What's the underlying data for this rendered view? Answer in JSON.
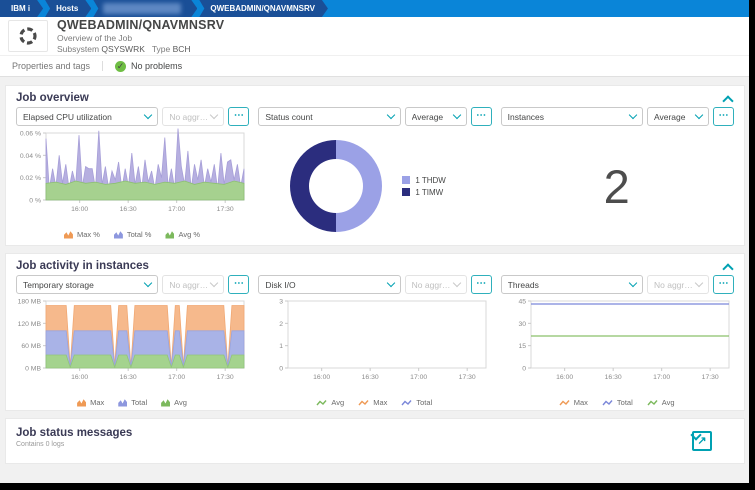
{
  "breadcrumb": {
    "items": [
      {
        "label": "IBM i",
        "redacted": false
      },
      {
        "label": "Hosts",
        "redacted": false
      },
      {
        "label": "",
        "redacted": true
      },
      {
        "label": "QWEBADMIN/QNAVMNSRV",
        "redacted": false
      }
    ]
  },
  "header": {
    "title": "QWEBADMIN/QNAVMNSRV",
    "subtitle": "Overview of the Job",
    "meta_label_1": "Subsystem",
    "meta_value_1": "QSYSWRK",
    "meta_label_2": "Type",
    "meta_value_2": "BCH"
  },
  "tabs": {
    "properties": "Properties and tags",
    "no_problems": "No problems"
  },
  "sections": {
    "overview_title": "Job overview",
    "activity_title": "Job activity in instances",
    "messages_title": "Job status messages",
    "messages_subtitle": "Contains 0 logs"
  },
  "colors": {
    "accent_teal": "#00a1b2",
    "topbar_blue": "#0a85d8",
    "breadcrumb_blue": "#1a4f97",
    "ok_green": "#6fbe44",
    "area_purple": "#b6afe0",
    "area_green": "#a6d18f",
    "band_orange": "#f6b98c",
    "band_blue": "#a9b3e7",
    "band_green": "#a4d38e",
    "donut_light": "#9ba1e6",
    "donut_dark": "#2b2d7e",
    "line_blue": "#7b87d9",
    "line_green": "#8ac06a"
  },
  "chart_data": [
    {
      "key": "cpu",
      "metric": "Elapsed CPU utilization",
      "aggregation": "No aggregation",
      "aggregation_enabled": false,
      "type": "area",
      "ylim": [
        0,
        0.06
      ],
      "yticks": [
        {
          "v": 0.06,
          "label": "0.06 %"
        },
        {
          "v": 0.04,
          "label": "0.04 %"
        },
        {
          "v": 0.02,
          "label": "0.02 %"
        },
        {
          "v": 0,
          "label": "0 %"
        }
      ],
      "xticks": [
        "16:00",
        "16:30",
        "17:00",
        "17:30"
      ],
      "series": [
        {
          "name": "Total %",
          "draw": "area",
          "color": "#b6afe0",
          "stroke": "#a79fd8",
          "values": [
            0.055,
            0.01,
            0.028,
            0.012,
            0.04,
            0.015,
            0.032,
            0.01,
            0.026,
            0.014,
            0.058,
            0.012,
            0.03,
            0.028,
            0.028,
            0.01,
            0.062,
            0.014,
            0.03,
            0.01,
            0.026,
            0.018,
            0.034,
            0.01,
            0.028,
            0.012,
            0.042,
            0.014,
            0.03,
            0.01,
            0.036,
            0.016,
            0.026,
            0.01,
            0.032,
            0.02,
            0.056,
            0.012,
            0.028,
            0.01,
            0.064,
            0.03,
            0.014,
            0.044,
            0.01,
            0.032,
            0.018,
            0.036,
            0.012,
            0.028,
            0.016,
            0.032,
            0.01,
            0.042,
            0.014,
            0.034,
            0.036,
            0.018,
            0.032,
            0.012,
            0.028
          ]
        },
        {
          "name": "Avg %",
          "draw": "area",
          "color": "#a6d18f",
          "stroke": "#8cbf72",
          "values": [
            0.015,
            0.016,
            0.014,
            0.017,
            0.015,
            0.016,
            0.014,
            0.015,
            0.017,
            0.015,
            0.016,
            0.014,
            0.016,
            0.015,
            0.017,
            0.014,
            0.016,
            0.015,
            0.014,
            0.017,
            0.015
          ]
        }
      ],
      "legend": [
        {
          "label": "Max %",
          "color": "#ef9a55",
          "style": "area"
        },
        {
          "label": "Total %",
          "color": "#8d97de",
          "style": "area"
        },
        {
          "label": "Avg %",
          "color": "#7cb95d",
          "style": "area"
        }
      ]
    },
    {
      "key": "status",
      "metric": "Status count",
      "aggregation": "Average",
      "aggregation_enabled": true,
      "type": "pie",
      "slices": [
        {
          "label": "1 THDW",
          "value": 1,
          "color": "#9ba1e6"
        },
        {
          "label": "1 TIMW",
          "value": 1,
          "color": "#2b2d7e"
        }
      ]
    },
    {
      "key": "instances",
      "metric": "Instances",
      "aggregation": "Average",
      "aggregation_enabled": true,
      "type": "number",
      "value": "2"
    },
    {
      "key": "tempstorage",
      "metric": "Temporary storage",
      "aggregation": "No aggregation",
      "aggregation_enabled": false,
      "type": "area",
      "ylim": [
        0,
        180
      ],
      "yticks": [
        {
          "v": 180,
          "label": "180 MB"
        },
        {
          "v": 120,
          "label": "120 MB"
        },
        {
          "v": 60,
          "label": "60 MB"
        },
        {
          "v": 0,
          "label": "0 MB"
        }
      ],
      "xticks": [
        "16:00",
        "16:30",
        "17:00",
        "17:30"
      ],
      "series": [
        {
          "name": "Max",
          "draw": "area",
          "color": "#f6b98c",
          "stroke": "#f1a873",
          "values": [
            168,
            168,
            168,
            168,
            168,
            168,
            5,
            168,
            168,
            168,
            168,
            168,
            168,
            168,
            168,
            168,
            168,
            6,
            168,
            168,
            168,
            4,
            168,
            168,
            168,
            168,
            168,
            168,
            168,
            168,
            168,
            5,
            168,
            168,
            6,
            168,
            168,
            168,
            168,
            168,
            168,
            168,
            168,
            168,
            168,
            4,
            168,
            168,
            168,
            168
          ]
        },
        {
          "name": "Total",
          "draw": "area",
          "color": "#a9b3e7",
          "stroke": "#99a4de",
          "values": [
            100,
            100,
            100,
            100,
            100,
            100,
            3,
            100,
            100,
            100,
            100,
            100,
            100,
            100,
            100,
            100,
            100,
            4,
            100,
            100,
            100,
            3,
            100,
            100,
            100,
            100,
            100,
            100,
            100,
            100,
            100,
            3,
            100,
            100,
            4,
            100,
            100,
            100,
            100,
            100,
            100,
            100,
            100,
            100,
            100,
            3,
            100,
            100,
            100,
            100
          ]
        },
        {
          "name": "Avg",
          "draw": "area",
          "color": "#a4d38e",
          "stroke": "#92c579",
          "values": [
            35,
            35,
            35,
            35,
            35,
            35,
            2,
            35,
            35,
            35,
            35,
            35,
            35,
            35,
            35,
            35,
            35,
            2,
            35,
            35,
            35,
            2,
            35,
            35,
            35,
            35,
            35,
            35,
            35,
            35,
            35,
            2,
            35,
            35,
            2,
            35,
            35,
            35,
            35,
            35,
            35,
            35,
            35,
            35,
            35,
            2,
            35,
            35,
            35,
            35
          ]
        }
      ],
      "legend": [
        {
          "label": "Max",
          "color": "#ef9a55",
          "style": "area"
        },
        {
          "label": "Total",
          "color": "#8d97de",
          "style": "area"
        },
        {
          "label": "Avg",
          "color": "#7cb95d",
          "style": "area"
        }
      ]
    },
    {
      "key": "diskio",
      "metric": "Disk I/O",
      "aggregation": "No aggregation",
      "aggregation_enabled": false,
      "type": "line",
      "ylim": [
        0,
        3
      ],
      "yticks": [
        {
          "v": 3,
          "label": "3"
        },
        {
          "v": 2,
          "label": "2"
        },
        {
          "v": 1,
          "label": "1"
        },
        {
          "v": 0,
          "label": "0"
        }
      ],
      "xticks": [
        "16:00",
        "16:30",
        "17:00",
        "17:30"
      ],
      "series": [],
      "legend": [
        {
          "label": "Avg",
          "color": "#7cb95d",
          "style": "line"
        },
        {
          "label": "Max",
          "color": "#ef9a55",
          "style": "line"
        },
        {
          "label": "Total",
          "color": "#7b87d9",
          "style": "line"
        }
      ]
    },
    {
      "key": "threads",
      "metric": "Threads",
      "aggregation": "No aggregation",
      "aggregation_enabled": false,
      "type": "line",
      "ylim": [
        0,
        45
      ],
      "yticks": [
        {
          "v": 45,
          "label": "45"
        },
        {
          "v": 30,
          "label": "30"
        },
        {
          "v": 15,
          "label": "15"
        },
        {
          "v": 0,
          "label": "0"
        }
      ],
      "xticks": [
        "16:00",
        "16:30",
        "17:00",
        "17:30"
      ],
      "series": [
        {
          "name": "Total",
          "draw": "line",
          "color": "#7b87d9",
          "values": [
            43,
            43
          ]
        },
        {
          "name": "Avg",
          "draw": "line",
          "color": "#8ac06a",
          "values": [
            21.5,
            21.5
          ]
        }
      ],
      "legend": [
        {
          "label": "Max",
          "color": "#ef9a55",
          "style": "line"
        },
        {
          "label": "Total",
          "color": "#7b87d9",
          "style": "line"
        },
        {
          "label": "Avg",
          "color": "#7cb95d",
          "style": "line"
        }
      ]
    }
  ]
}
